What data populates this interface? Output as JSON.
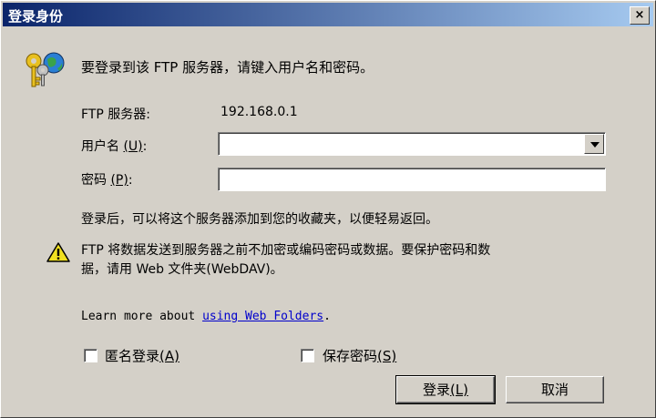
{
  "window": {
    "title": "登录身份",
    "close_label": "×"
  },
  "header": {
    "message": "要登录到该 FTP 服务器，请键入用户名和密码。"
  },
  "form": {
    "server_label": "FTP 服务器:",
    "server_value": "192.168.0.1",
    "username_label": "用户名",
    "username_hotkey": "(U)",
    "username_suffix": ":",
    "username_value": "",
    "password_label": "密码",
    "password_hotkey": "(P)",
    "password_suffix": ":",
    "password_value": ""
  },
  "info": {
    "favorites_note": "登录后，可以将这个服务器添加到您的收藏夹，以便轻易返回。",
    "warning_line1": "FTP 将数据发送到服务器之前不加密或编码密码或数据。要保护密码和数",
    "warning_line2": "据，请用 Web 文件夹(WebDAV)。",
    "learn_prefix": "Learn more about ",
    "learn_link": "using Web Folders",
    "learn_suffix": "."
  },
  "options": {
    "anonymous_label": "匿名登录",
    "anonymous_hotkey": "(A)",
    "anonymous_checked": false,
    "save_password_label": "保存密码",
    "save_password_hotkey": "(S)",
    "save_password_checked": false
  },
  "buttons": {
    "login_label": "登录",
    "login_hotkey": "(L)",
    "cancel_label": "取消"
  },
  "icons": {
    "header_icon": "keys-globe-icon",
    "warning_icon": "warning-icon"
  },
  "colors": {
    "titlebar_start": "#0a246a",
    "titlebar_end": "#a6caf0",
    "face": "#d4d0c8",
    "link": "#0000cc"
  }
}
